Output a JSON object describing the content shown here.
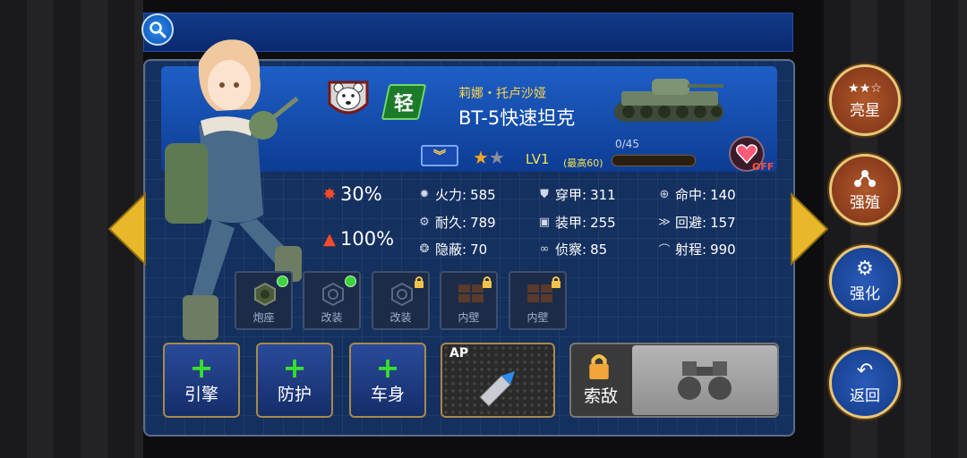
{
  "tank": {
    "class_label": "轻",
    "crew_name": "莉娜・托卢沙娅",
    "name": "BT-5快速坦克",
    "level": "LV1",
    "max_level": "(最高60)",
    "xp": "0/45",
    "xp_progress": 0,
    "stars_filled": 1,
    "stars_total": 2,
    "favorite_state": "OFF"
  },
  "bonuses": [
    {
      "icon": "attack-explosion-icon",
      "value": "30%"
    },
    {
      "icon": "tank-health-icon",
      "value": "100%"
    }
  ],
  "stats": {
    "firepower": {
      "label": "火力:",
      "value": "585"
    },
    "durability": {
      "label": "耐久:",
      "value": "789"
    },
    "stealth": {
      "label": "隐蔽:",
      "value": "70"
    },
    "penetration": {
      "label": "穿甲:",
      "value": "311"
    },
    "armor": {
      "label": "装甲:",
      "value": "255"
    },
    "recon": {
      "label": "侦察:",
      "value": "85"
    },
    "accuracy": {
      "label": "命中:",
      "value": "140"
    },
    "evasion": {
      "label": "回避:",
      "value": "157"
    },
    "range": {
      "label": "射程:",
      "value": "990"
    }
  },
  "slots": [
    {
      "label": "炮座",
      "state": "available"
    },
    {
      "label": "改装",
      "state": "available"
    },
    {
      "label": "改装",
      "state": "locked"
    },
    {
      "label": "内壁",
      "state": "locked"
    },
    {
      "label": "内壁",
      "state": "locked"
    }
  ],
  "upgrades": [
    {
      "label": "引擎"
    },
    {
      "label": "防护"
    },
    {
      "label": "车身"
    }
  ],
  "ammo": {
    "tag": "AP"
  },
  "scout": {
    "label": "索敌"
  },
  "side_menu": [
    {
      "label": "亮星",
      "icon": "stars-icon"
    },
    {
      "label": "强殖",
      "icon": "molecule-icon"
    },
    {
      "label": "强化",
      "icon": "wrench-gear-icon"
    },
    {
      "label": "返回",
      "icon": "back-arrow-icon"
    }
  ],
  "colors": {
    "accent_gold": "#f3e34b",
    "panel_blue": "#14305f",
    "plus_green": "#39e02a",
    "off_red": "#ff4d3d"
  }
}
